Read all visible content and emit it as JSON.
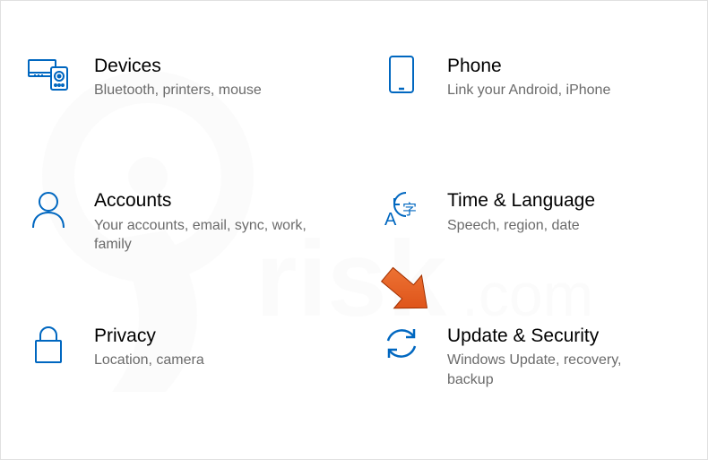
{
  "tiles": [
    {
      "title": "Devices",
      "desc": "Bluetooth, printers, mouse"
    },
    {
      "title": "Phone",
      "desc": "Link your Android, iPhone"
    },
    {
      "title": "Accounts",
      "desc": "Your accounts, email, sync, work, family"
    },
    {
      "title": "Time & Language",
      "desc": "Speech, region, date"
    },
    {
      "title": "Privacy",
      "desc": "Location, camera"
    },
    {
      "title": "Update & Security",
      "desc": "Windows Update, recovery, backup"
    }
  ],
  "accent_color": "#0067c0",
  "arrow_color": "#e55a1f"
}
